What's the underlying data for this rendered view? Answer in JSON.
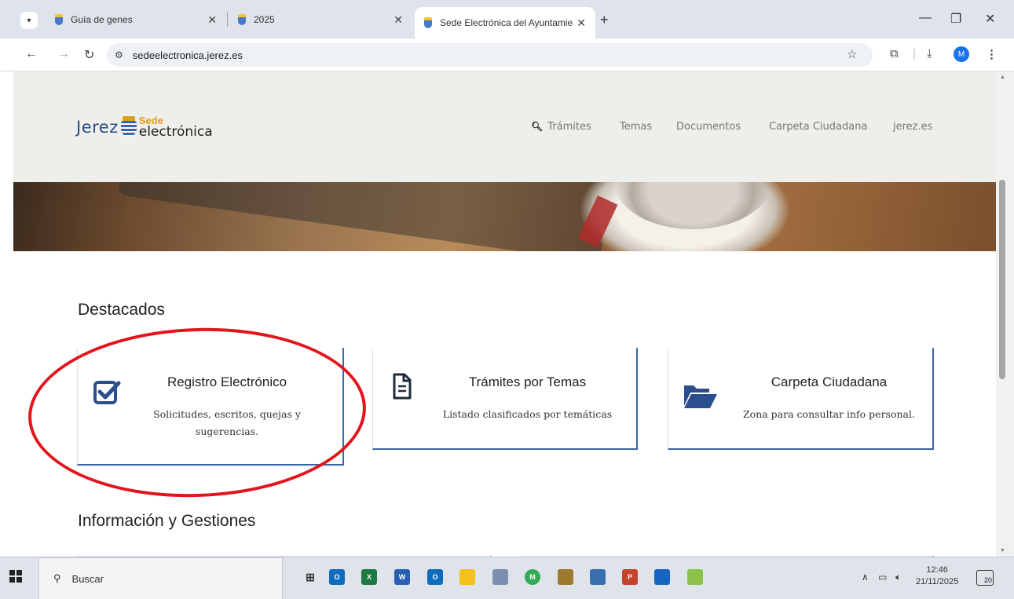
{
  "browser": {
    "tabs": [
      {
        "title": "Guía de genes"
      },
      {
        "title": "2025"
      },
      {
        "title": "Sede Electrónica del Ayuntamie"
      }
    ],
    "url": "sedeelectronica.jerez.es",
    "profile_initial": "M"
  },
  "site": {
    "logo": {
      "jerez": "Jerez",
      "sede": "Sede",
      "electronica": "electrónica"
    },
    "nav": [
      "Trámites",
      "Temas",
      "Documentos",
      "Carpeta Ciudadana",
      "jerez.es"
    ]
  },
  "sections": {
    "featured_title": "Destacados",
    "info_title": "Información y Gestiones"
  },
  "cards": [
    {
      "title": "Registro Electrónico",
      "desc_line1": "Solicitudes, escritos, quejas y",
      "desc_line2": "sugerencias.",
      "icon": "checkbox-icon"
    },
    {
      "title": "Trámites por Temas",
      "desc_line1": "Listado clasificados por temáticas",
      "icon": "document-icon"
    },
    {
      "title": "Carpeta Ciudadana",
      "desc_line1": "Zona para consultar info personal.",
      "icon": "folder-icon"
    }
  ],
  "taskbar": {
    "search_placeholder": "Buscar",
    "time": "12:46",
    "date": "21/11/2025",
    "notifications": "20"
  },
  "colors": {
    "brand_blue": "#2a4e8e",
    "card_border": "#3b66a8",
    "annotation": "#e3141b"
  }
}
